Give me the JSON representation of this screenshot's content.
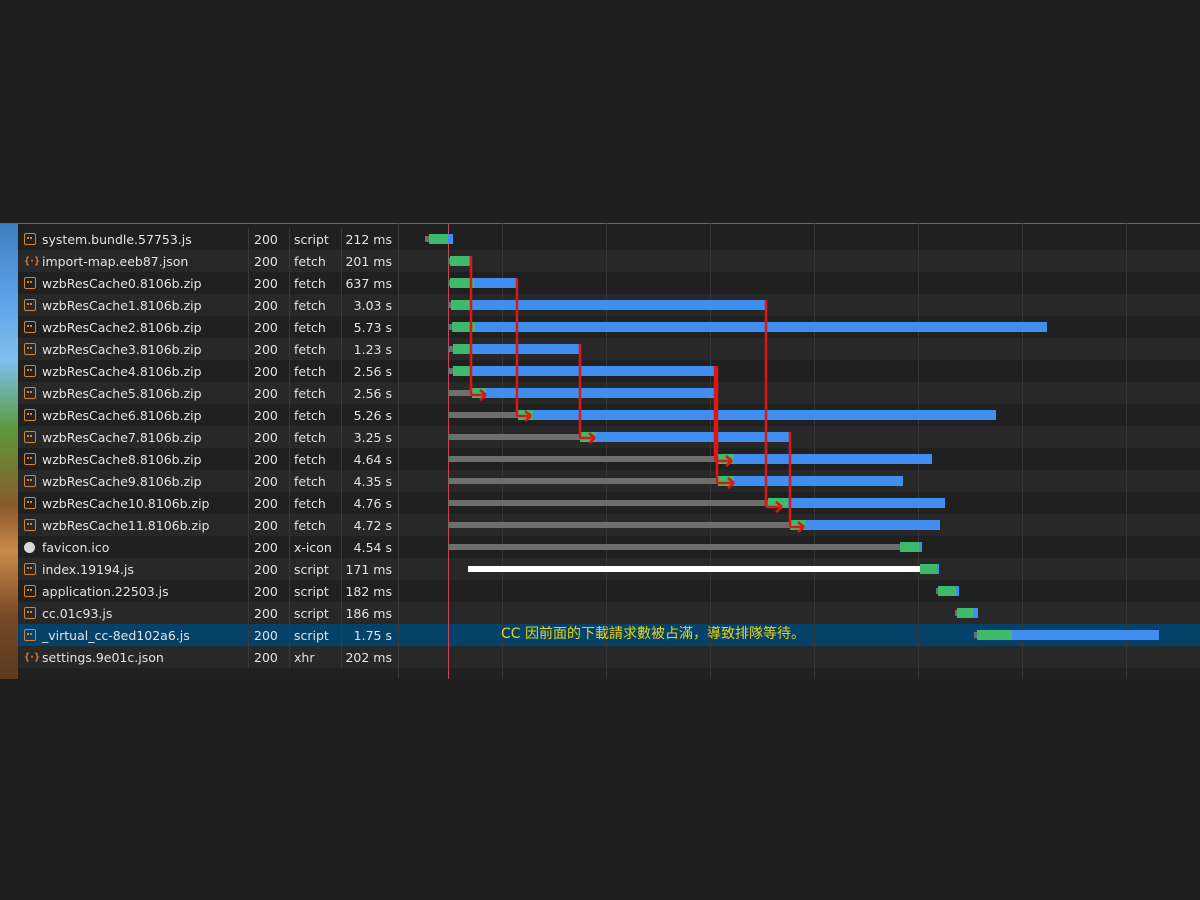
{
  "requests": [
    {
      "name": "system.bundle.57753.js",
      "status": "200",
      "type": "script",
      "time": "212 ms",
      "icon": "file-icon"
    },
    {
      "name": "import-map.eeb87.json",
      "status": "200",
      "type": "fetch",
      "time": "201 ms",
      "icon": "json-icon"
    },
    {
      "name": "wzbResCache0.8106b.zip",
      "status": "200",
      "type": "fetch",
      "time": "637 ms",
      "icon": "file-icon"
    },
    {
      "name": "wzbResCache1.8106b.zip",
      "status": "200",
      "type": "fetch",
      "time": "3.03 s",
      "icon": "file-icon"
    },
    {
      "name": "wzbResCache2.8106b.zip",
      "status": "200",
      "type": "fetch",
      "time": "5.73 s",
      "icon": "file-icon"
    },
    {
      "name": "wzbResCache3.8106b.zip",
      "status": "200",
      "type": "fetch",
      "time": "1.23 s",
      "icon": "file-icon"
    },
    {
      "name": "wzbResCache4.8106b.zip",
      "status": "200",
      "type": "fetch",
      "time": "2.56 s",
      "icon": "file-icon"
    },
    {
      "name": "wzbResCache5.8106b.zip",
      "status": "200",
      "type": "fetch",
      "time": "2.56 s",
      "icon": "file-icon"
    },
    {
      "name": "wzbResCache6.8106b.zip",
      "status": "200",
      "type": "fetch",
      "time": "5.26 s",
      "icon": "file-icon"
    },
    {
      "name": "wzbResCache7.8106b.zip",
      "status": "200",
      "type": "fetch",
      "time": "3.25 s",
      "icon": "file-icon"
    },
    {
      "name": "wzbResCache8.8106b.zip",
      "status": "200",
      "type": "fetch",
      "time": "4.64 s",
      "icon": "file-icon"
    },
    {
      "name": "wzbResCache9.8106b.zip",
      "status": "200",
      "type": "fetch",
      "time": "4.35 s",
      "icon": "file-icon"
    },
    {
      "name": "wzbResCache10.8106b.zip",
      "status": "200",
      "type": "fetch",
      "time": "4.76 s",
      "icon": "file-icon"
    },
    {
      "name": "wzbResCache11.8106b.zip",
      "status": "200",
      "type": "fetch",
      "time": "4.72 s",
      "icon": "file-icon"
    },
    {
      "name": "favicon.ico",
      "status": "200",
      "type": "x-icon",
      "time": "4.54 s",
      "icon": "circle-icon"
    },
    {
      "name": "index.19194.js",
      "status": "200",
      "type": "script",
      "time": "171 ms",
      "icon": "file-icon"
    },
    {
      "name": "application.22503.js",
      "status": "200",
      "type": "script",
      "time": "182 ms",
      "icon": "file-icon"
    },
    {
      "name": "cc.01c93.js",
      "status": "200",
      "type": "script",
      "time": "186 ms",
      "icon": "file-icon"
    },
    {
      "name": "_virtual_cc-8ed102a6.js",
      "status": "200",
      "type": "script",
      "time": "1.75 s",
      "icon": "file-icon"
    },
    {
      "name": "settings.9e01c.json",
      "status": "200",
      "type": "xhr",
      "time": "202 ms",
      "icon": "json-icon"
    }
  ],
  "annotation": "CC 因前面的下載請求數被占滿，導致排隊等待。",
  "colors": {
    "waiting": "#6e6e6e",
    "stalled": "#ffffff",
    "ttfb": "#3dba6a",
    "download": "#3f8ef0",
    "arrow": "#dd1616",
    "annotation": "#e8d31a",
    "selected_row": "#04426a"
  }
}
